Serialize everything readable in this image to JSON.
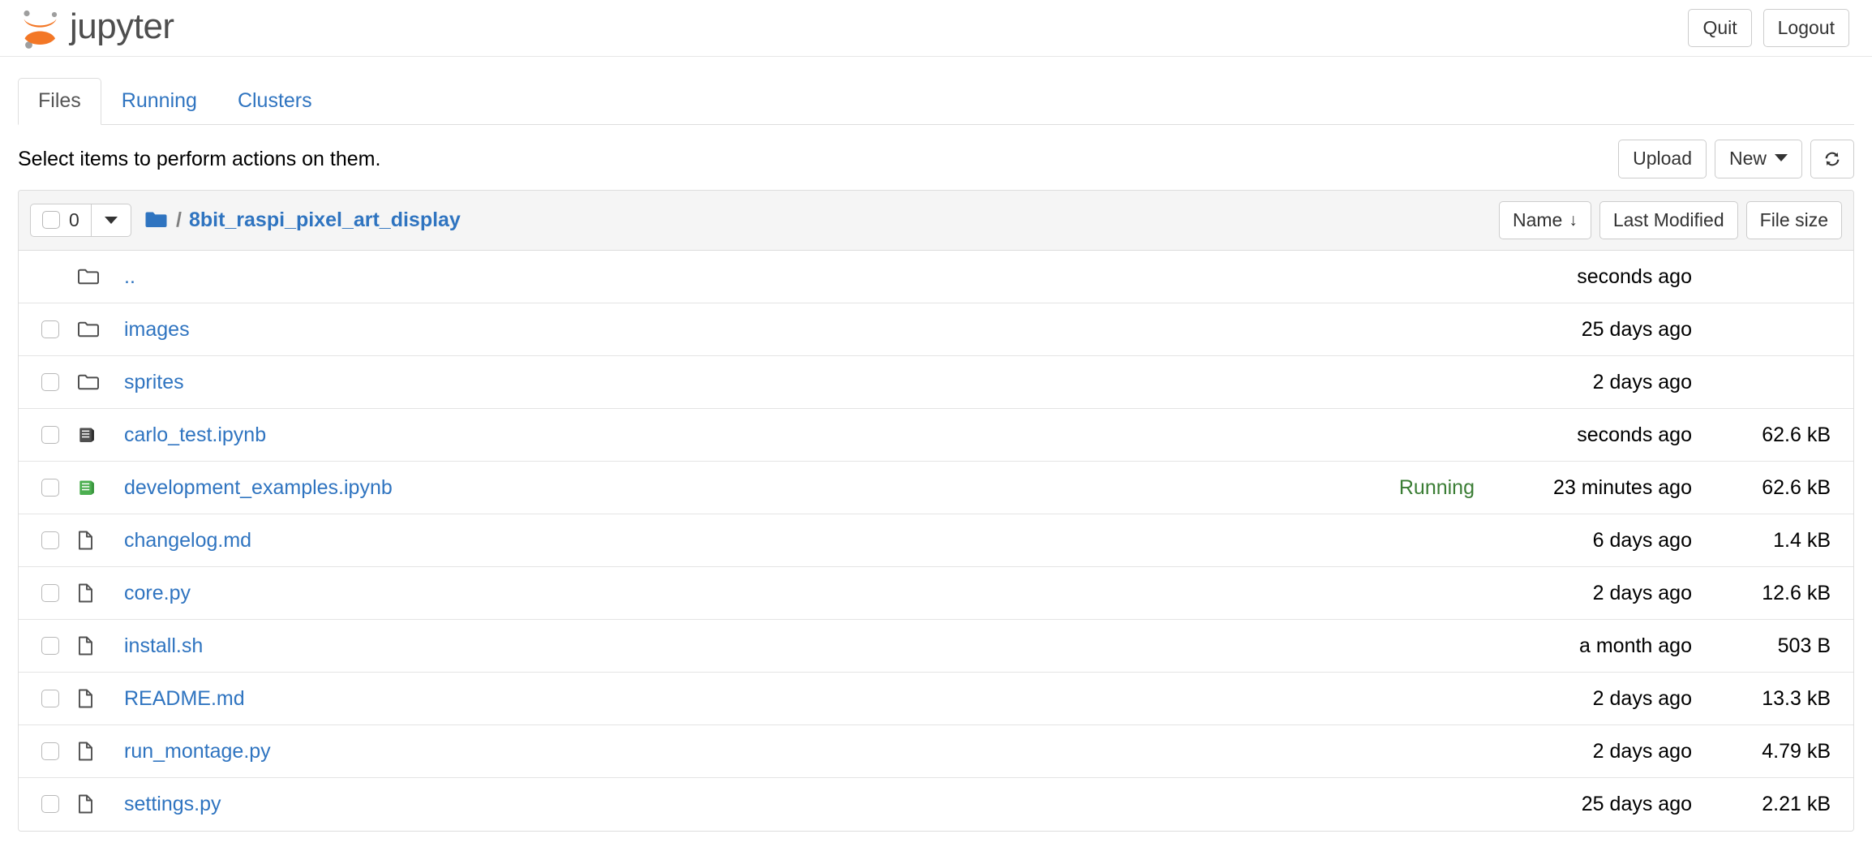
{
  "header": {
    "brand": "jupyter",
    "logo_icon": "jupyter-logo",
    "logo_color": "#f37726",
    "logo_dot_color": "#9e9e9e",
    "quit_label": "Quit",
    "logout_label": "Logout"
  },
  "tabs": [
    {
      "label": "Files",
      "active": true
    },
    {
      "label": "Running",
      "active": false
    },
    {
      "label": "Clusters",
      "active": false
    }
  ],
  "action_bar": {
    "note": "Select items to perform actions on them.",
    "upload_label": "Upload",
    "new_label": "New",
    "new_caret_icon": "chevron-down-icon",
    "refresh_icon": "refresh-icon"
  },
  "breadcrumb": {
    "select_all_count": "0",
    "select_all_checkbox_icon": "checkbox-unchecked-icon",
    "select_dropdown_icon": "chevron-down-icon",
    "folder_icon": "folder-filled-icon",
    "separator": "/",
    "path": "8bit_raspi_pixel_art_display"
  },
  "sort_buttons": [
    {
      "label": "Name",
      "arrow": "↓",
      "icon": "sort-down-icon"
    },
    {
      "label": "Last Modified",
      "arrow": "",
      "icon": ""
    },
    {
      "label": "File size",
      "arrow": "",
      "icon": ""
    }
  ],
  "colors": {
    "link": "#2f74c0",
    "running": "#3a7d34",
    "notebook_stopped": "#4f4f4f",
    "notebook_running": "#4caf50",
    "folder_outline": "#4f4f4f",
    "folder_filled": "#2f74c0",
    "file_outline": "#4f4f4f",
    "header_bg": "#f5f5f5",
    "border": "#dddddd"
  },
  "files": [
    {
      "name": "..",
      "icon": "folder-icon",
      "type": "parent",
      "has_checkbox": false,
      "status": "",
      "modified": "seconds ago",
      "size": ""
    },
    {
      "name": "images",
      "icon": "folder-icon",
      "type": "folder",
      "has_checkbox": true,
      "status": "",
      "modified": "25 days ago",
      "size": ""
    },
    {
      "name": "sprites",
      "icon": "folder-icon",
      "type": "folder",
      "has_checkbox": true,
      "status": "",
      "modified": "2 days ago",
      "size": ""
    },
    {
      "name": "carlo_test.ipynb",
      "icon": "notebook-icon",
      "type": "notebook",
      "has_checkbox": true,
      "status": "",
      "modified": "seconds ago",
      "size": "62.6 kB"
    },
    {
      "name": "development_examples.ipynb",
      "icon": "notebook-running-icon",
      "type": "notebook-running",
      "has_checkbox": true,
      "status": "Running",
      "modified": "23 minutes ago",
      "size": "62.6 kB"
    },
    {
      "name": "changelog.md",
      "icon": "file-icon",
      "type": "file",
      "has_checkbox": true,
      "status": "",
      "modified": "6 days ago",
      "size": "1.4 kB"
    },
    {
      "name": "core.py",
      "icon": "file-icon",
      "type": "file",
      "has_checkbox": true,
      "status": "",
      "modified": "2 days ago",
      "size": "12.6 kB"
    },
    {
      "name": "install.sh",
      "icon": "file-icon",
      "type": "file",
      "has_checkbox": true,
      "status": "",
      "modified": "a month ago",
      "size": "503 B"
    },
    {
      "name": "README.md",
      "icon": "file-icon",
      "type": "file",
      "has_checkbox": true,
      "status": "",
      "modified": "2 days ago",
      "size": "13.3 kB"
    },
    {
      "name": "run_montage.py",
      "icon": "file-icon",
      "type": "file",
      "has_checkbox": true,
      "status": "",
      "modified": "2 days ago",
      "size": "4.79 kB"
    },
    {
      "name": "settings.py",
      "icon": "file-icon",
      "type": "file",
      "has_checkbox": true,
      "status": "",
      "modified": "25 days ago",
      "size": "2.21 kB"
    }
  ]
}
